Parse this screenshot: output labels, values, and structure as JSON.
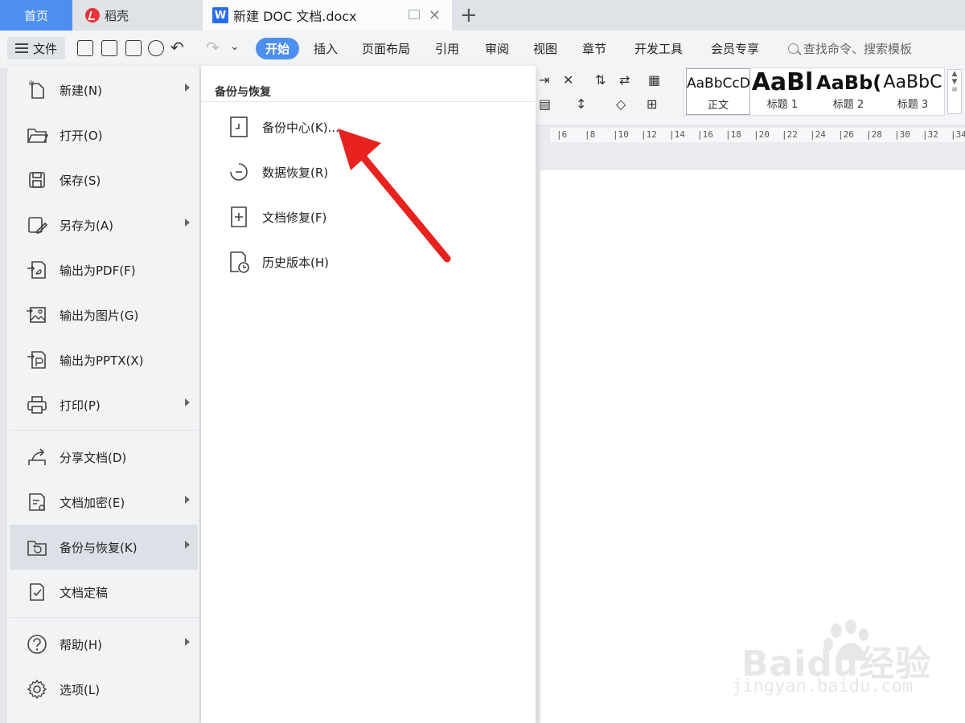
{
  "tabs": {
    "home_label": "首页",
    "docer_label": "稻壳",
    "doc_title": "新建 DOC 文档.docx",
    "doc_icon_letter": "W",
    "add_symbol": "+",
    "close_symbol": "✕"
  },
  "menubar": {
    "file_label": "文件",
    "tabs": [
      "开始",
      "插入",
      "页面布局",
      "引用",
      "审阅",
      "视图",
      "章节",
      "开发工具",
      "会员专享"
    ],
    "active_tab": "开始",
    "search_placeholder": "查找命令、搜索模板"
  },
  "styles_gallery": [
    {
      "sample": "AaBbCcDc",
      "name": "正文"
    },
    {
      "sample": "AaBl",
      "name": "标题 1"
    },
    {
      "sample": "AaBb(",
      "name": "标题 2"
    },
    {
      "sample": "AaBbC",
      "name": "标题 3"
    }
  ],
  "ruler_numbers": [
    "6",
    "8",
    "10",
    "12",
    "14",
    "16",
    "18",
    "20",
    "22",
    "24",
    "26",
    "28",
    "30",
    "32",
    "34"
  ],
  "file_menu": {
    "items": [
      {
        "label": "新建(N)",
        "icon": "new-doc-icon",
        "has_submenu": true
      },
      {
        "label": "打开(O)",
        "icon": "folder-open-icon",
        "has_submenu": false
      },
      {
        "label": "保存(S)",
        "icon": "save-icon",
        "has_submenu": false
      },
      {
        "label": "另存为(A)",
        "icon": "save-as-icon",
        "has_submenu": true
      },
      {
        "label": "输出为PDF(F)",
        "icon": "export-pdf-icon",
        "has_submenu": false
      },
      {
        "label": "输出为图片(G)",
        "icon": "export-image-icon",
        "has_submenu": false
      },
      {
        "label": "输出为PPTX(X)",
        "icon": "export-pptx-icon",
        "has_submenu": false
      },
      {
        "label": "打印(P)",
        "icon": "print-icon",
        "has_submenu": true
      },
      {
        "label": "分享文档(D)",
        "icon": "share-icon",
        "has_submenu": false
      },
      {
        "label": "文档加密(E)",
        "icon": "encrypt-icon",
        "has_submenu": true
      },
      {
        "label": "备份与恢复(K)",
        "icon": "backup-restore-icon",
        "has_submenu": true,
        "active": true
      },
      {
        "label": "文档定稿",
        "icon": "finalize-icon",
        "has_submenu": false
      },
      {
        "label": "帮助(H)",
        "icon": "help-icon",
        "has_submenu": true
      },
      {
        "label": "选项(L)",
        "icon": "options-gear-icon",
        "has_submenu": false
      }
    ]
  },
  "submenu": {
    "title": "备份与恢复",
    "items": [
      {
        "label": "备份中心(K)...",
        "icon": "backup-center-icon"
      },
      {
        "label": "数据恢复(R)",
        "icon": "data-recovery-icon"
      },
      {
        "label": "文档修复(F)",
        "icon": "doc-repair-icon"
      },
      {
        "label": "历史版本(H)",
        "icon": "history-version-icon"
      }
    ]
  },
  "watermark": {
    "brand": "Baidu经验",
    "url": "jingyan.baidu.com"
  },
  "colors": {
    "accent": "#4d8ff0",
    "annotation_arrow": "#e8231f",
    "menu_active_bg": "#dde1e7"
  }
}
